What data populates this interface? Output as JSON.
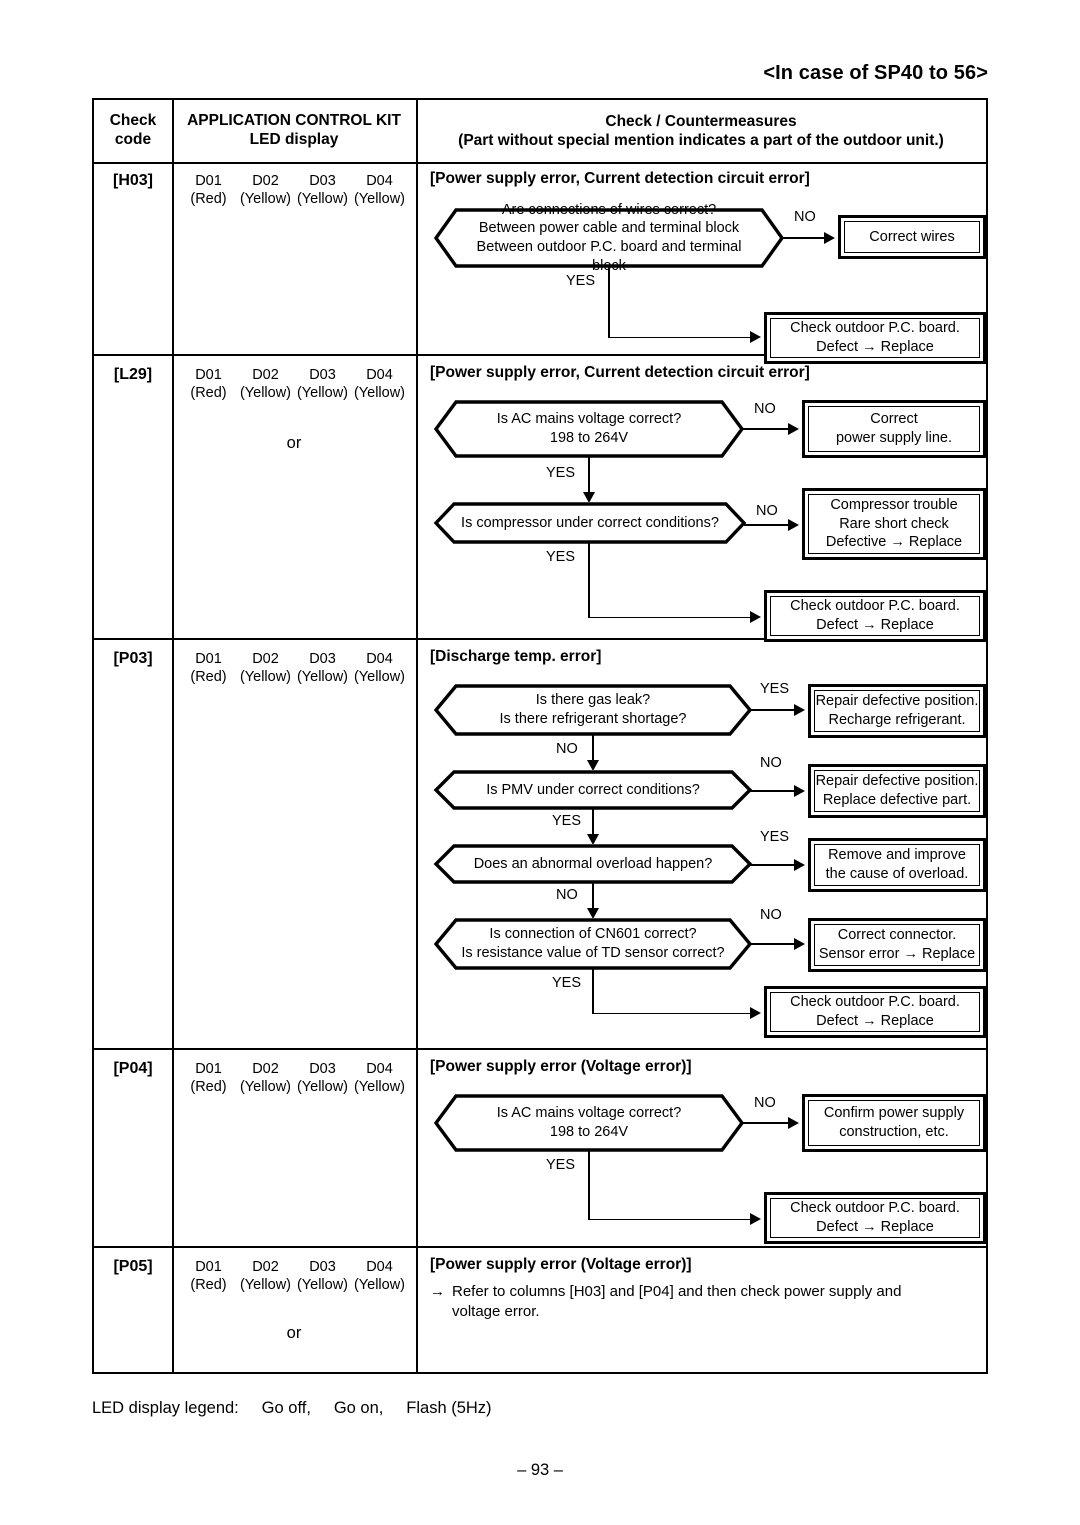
{
  "document": {
    "title": "<In case of SP40 to 56>",
    "page_number": "– 93 –",
    "legend": "LED display legend:     Go off,     Go on,     Flash (5Hz)"
  },
  "table": {
    "headers": {
      "check_code": [
        "Check",
        "code"
      ],
      "led_display": [
        "APPLICATION CONTROL KIT",
        "LED display"
      ],
      "countermeasures": [
        "Check / Countermeasures",
        "(Part without special mention indicates a part of the outdoor unit.)"
      ]
    },
    "led_names": [
      "D01",
      "D02",
      "D03",
      "D04"
    ],
    "led_colors": [
      "(Red)",
      "(Yellow)",
      "(Yellow)",
      "(Yellow)"
    ],
    "or_label": "or"
  },
  "rows": {
    "h03": {
      "code": "[H03]",
      "error_title": "[Power supply error, Current detection circuit error]",
      "d1_lines": [
        "Are connections of wires correct?",
        "Between power cable and terminal block",
        "Between outdoor P.C. board and terminal block"
      ],
      "d1_no": "NO",
      "d1_yes": "YES",
      "a1_lines": [
        "Correct wires"
      ],
      "a2_lines": [
        "Check outdoor P.C. board.",
        "Defect → Replace"
      ]
    },
    "l29": {
      "code": "[L29]",
      "error_title": "[Power supply error, Current detection circuit error]",
      "d1_lines": [
        "Is AC mains voltage correct?",
        "198 to 264V"
      ],
      "d1_no": "NO",
      "d1_yes": "YES",
      "a1_lines": [
        "Correct",
        "power supply line."
      ],
      "d2_lines": [
        "Is compressor under correct conditions?"
      ],
      "d2_no": "NO",
      "d2_yes": "YES",
      "a2_lines": [
        "Compressor trouble",
        "Rare short check",
        "Defective → Replace"
      ],
      "a3_lines": [
        "Check outdoor P.C. board.",
        "Defect → Replace"
      ]
    },
    "p03": {
      "code": "[P03]",
      "error_title": "[Discharge temp. error]",
      "d1_lines": [
        "Is there gas leak?",
        "Is there refrigerant shortage?"
      ],
      "d1_yes": "YES",
      "d1_no": "NO",
      "a1_lines": [
        "Repair defective position.",
        "Recharge refrigerant."
      ],
      "d2_lines": [
        "Is PMV under correct conditions?"
      ],
      "d2_no": "NO",
      "d2_yes": "YES",
      "a2_lines": [
        "Repair defective position.",
        "Replace defective part."
      ],
      "d3_lines": [
        "Does an abnormal overload happen?"
      ],
      "d3_yes": "YES",
      "d3_no": "NO",
      "a3_lines": [
        "Remove and improve",
        "the cause of overload."
      ],
      "d4_lines": [
        "Is connection of CN601 correct?",
        "Is resistance value of TD sensor correct?"
      ],
      "d4_no": "NO",
      "d4_yes": "YES",
      "a4_lines": [
        "Correct connector.",
        "Sensor error → Replace"
      ],
      "a5_lines": [
        "Check outdoor P.C. board.",
        "Defect → Replace"
      ]
    },
    "p04": {
      "code": "[P04]",
      "error_title": "[Power supply error (Voltage error)]",
      "d1_lines": [
        "Is AC mains voltage correct?",
        "198 to 264V"
      ],
      "d1_no": "NO",
      "d1_yes": "YES",
      "a1_lines": [
        "Confirm power supply",
        "construction, etc."
      ],
      "a2_lines": [
        "Check outdoor P.C. board.",
        "Defect → Replace"
      ]
    },
    "p05": {
      "code": "[P05]",
      "error_title": "[Power supply error (Voltage error)]",
      "note_arrow": "→",
      "note_lines": [
        "Refer to columns [H03] and [P04] and then check power supply and",
        "voltage error."
      ]
    }
  }
}
